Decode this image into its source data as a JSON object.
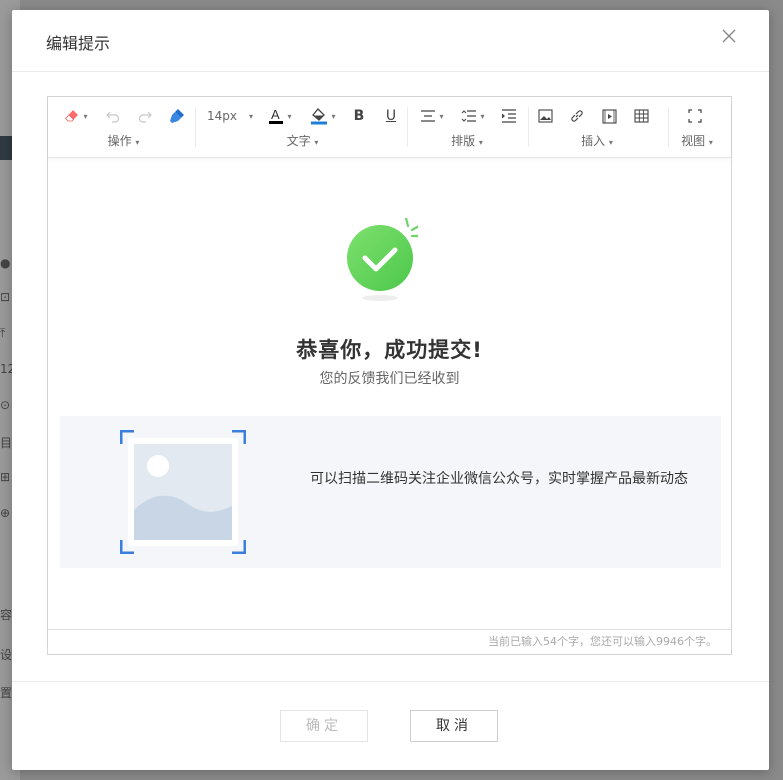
{
  "background_glyphs": [
    "●",
    "⊡",
    "⤒",
    "123",
    "⊙",
    "目",
    "⊞",
    "⊕",
    "容",
    "设",
    "置"
  ],
  "dialog": {
    "title": "编辑提示",
    "close_icon": "close-icon"
  },
  "toolbar": {
    "groups": [
      {
        "label": "操作",
        "icons": [
          "eraser-icon",
          "undo-icon",
          "redo-icon",
          "format-brush-icon"
        ]
      },
      {
        "label": "文字",
        "font_size": "14px",
        "icons": [
          "font-color-icon",
          "background-color-icon",
          "bold-icon",
          "underline-icon"
        ]
      },
      {
        "label": "排版",
        "icons": [
          "align-icon",
          "line-height-icon",
          "indent-icon"
        ]
      },
      {
        "label": "插入",
        "icons": [
          "image-icon",
          "link-icon",
          "video-icon",
          "table-icon"
        ]
      },
      {
        "label": "视图",
        "icons": [
          "fullscreen-icon"
        ]
      }
    ],
    "font_color": "#000000",
    "bg_color": "#1e7fd6"
  },
  "content": {
    "success_icon": "check-circle-icon",
    "headline": "恭喜你，成功提交!",
    "subline": "您的反馈我们已经收到",
    "qr_image_icon": "image-placeholder-icon",
    "qr_text": "可以扫描二维码关注企业微信公众号，实时掌握产品最新动态"
  },
  "status": {
    "text": "当前已输入54个字，您还可以输入9946个字。"
  },
  "footer": {
    "confirm_label": "确定",
    "cancel_label": "取消"
  },
  "colors": {
    "success_green": "#5fd35c",
    "accent_blue": "#3a7ee0"
  }
}
